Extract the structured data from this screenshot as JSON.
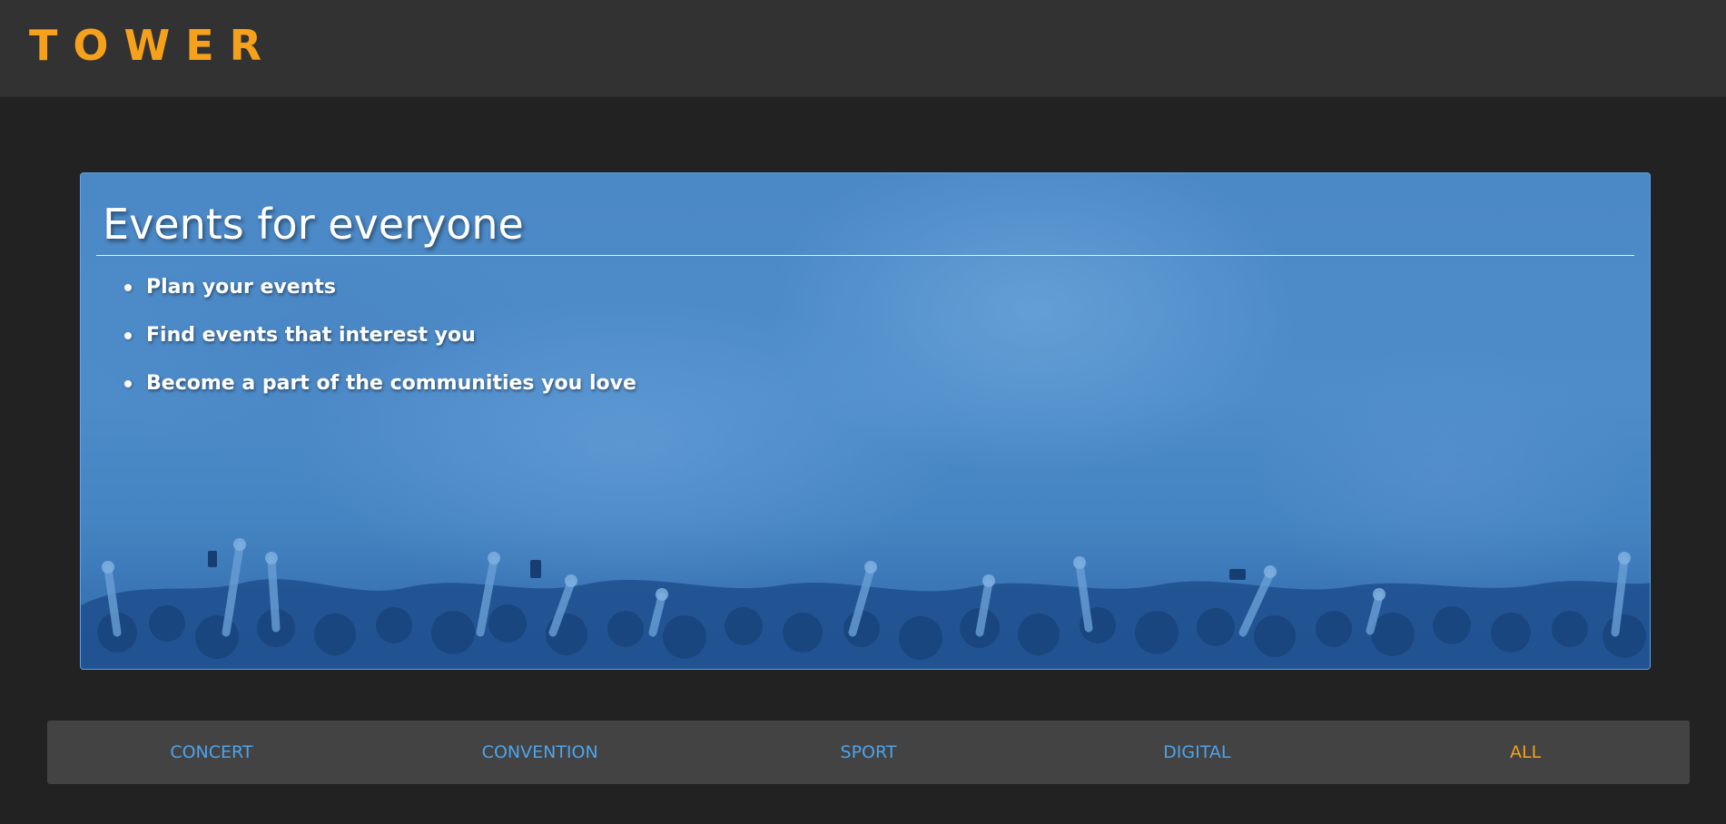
{
  "header": {
    "brand": "TOWER"
  },
  "hero": {
    "title": "Events for everyone",
    "items": [
      "Plan your events",
      "Find events that interest you",
      "Become a part of the communities you love"
    ],
    "image": "crowd-concert-photo"
  },
  "nav": {
    "items": [
      {
        "label": "CONCERT",
        "active": false
      },
      {
        "label": "CONVENTION",
        "active": false
      },
      {
        "label": "SPORT",
        "active": false
      },
      {
        "label": "DIGITAL",
        "active": false
      },
      {
        "label": "ALL",
        "active": true
      }
    ]
  },
  "colors": {
    "brand": "#f5a11b",
    "link": "#4da3ea",
    "active": "#f5a11b",
    "hero_tint": "#4b88c6",
    "page_bg": "#222222",
    "topbar_bg": "#323232",
    "nav_bg": "#434343"
  }
}
